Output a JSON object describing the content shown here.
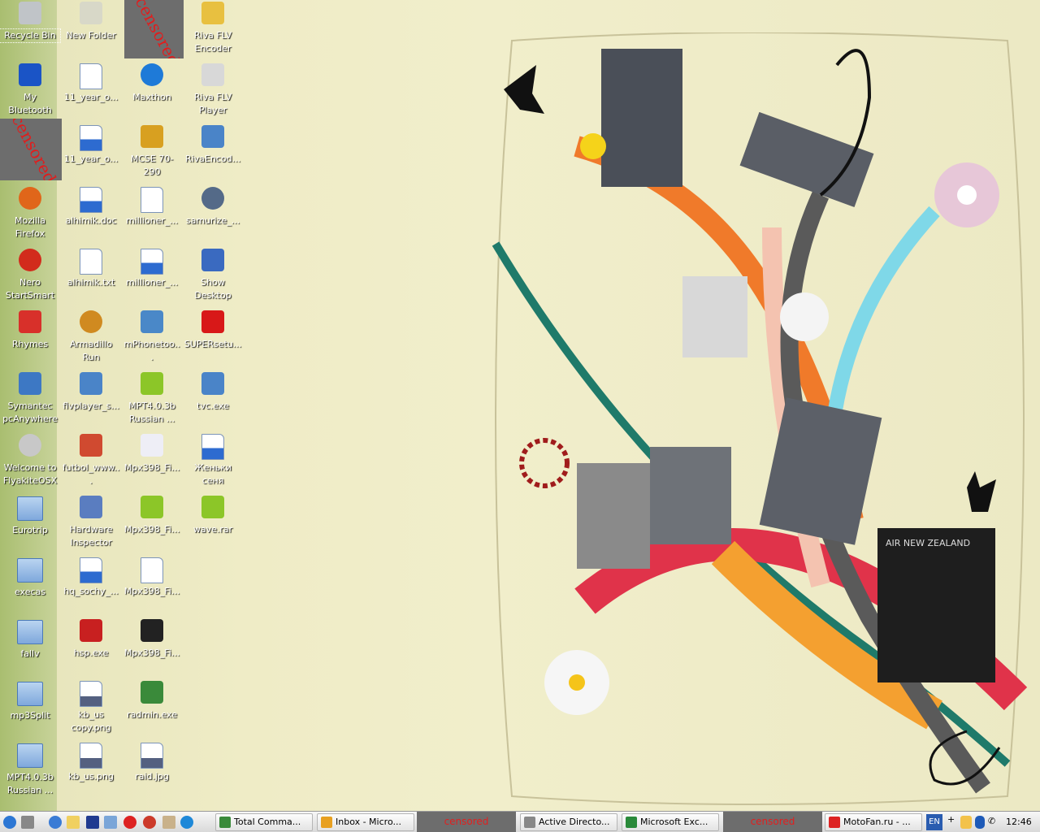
{
  "desktop_icons": [
    {
      "label": "Recycle Bin",
      "icon": "recycle-bin-icon",
      "selected": true
    },
    {
      "label": "My Bluetooth Places",
      "icon": "bluetooth-icon"
    },
    {
      "label": "Mozilla Firefox",
      "icon": "firefox-icon"
    },
    {
      "label": "Nero StartSmart",
      "icon": "nero-icon"
    },
    {
      "label": "Rhymes",
      "icon": "rhymes-icon"
    },
    {
      "label": "Symantec pcAnywhere",
      "icon": "pcanywhere-icon"
    },
    {
      "label": "Welcome to FlyakiteOSX",
      "icon": "flyakite-icon"
    },
    {
      "label": "Eurotrip",
      "icon": "folder-icon"
    },
    {
      "label": "execas",
      "icon": "folder-icon"
    },
    {
      "label": "fallv",
      "icon": "folder-icon"
    },
    {
      "label": "mp3Split",
      "icon": "folder-icon"
    },
    {
      "label": "MPT4.0.3b Russian ...",
      "icon": "folder-icon"
    },
    {
      "label": "New Folder",
      "icon": "help-folder-icon"
    },
    {
      "label": "11_year_o...",
      "icon": "document-icon"
    },
    {
      "label": "11_year_o...",
      "icon": "word-document-icon"
    },
    {
      "label": "alhimik.doc",
      "icon": "word-document-icon"
    },
    {
      "label": "alhimik.txt",
      "icon": "text-file-icon"
    },
    {
      "label": "Armadillo Run",
      "icon": "armadillo-icon"
    },
    {
      "label": "flvplayer_s...",
      "icon": "installer-icon"
    },
    {
      "label": "futbol_www...",
      "icon": "calendar-file-icon"
    },
    {
      "label": "Hardware Inspector",
      "icon": "hardware-inspector-icon"
    },
    {
      "label": "hq_sochy_...",
      "icon": "word-document-icon"
    },
    {
      "label": "hsp.exe",
      "icon": "hsp-exe-icon"
    },
    {
      "label": "kb_us copy.png",
      "icon": "png-file-icon"
    },
    {
      "label": "kb_us.png",
      "icon": "png-file-icon"
    },
    {
      "label": "Maxthon",
      "icon": "maxthon-icon"
    },
    {
      "label": "MCSE 70-290",
      "icon": "gear-icon"
    },
    {
      "label": "millioner_...",
      "icon": "document-icon"
    },
    {
      "label": "millioner_...",
      "icon": "word-document-icon"
    },
    {
      "label": "mPhonetoo...",
      "icon": "phone-tool-icon"
    },
    {
      "label": "MPT4.0.3b Russian ...",
      "icon": "archive-icon"
    },
    {
      "label": "Mpx398_Fi...",
      "icon": "blank-window-icon"
    },
    {
      "label": "Mpx398_Fi...",
      "icon": "archive-icon"
    },
    {
      "label": "Mpx398_Fi...",
      "icon": "blank-file-icon"
    },
    {
      "label": "Mpx398_Fi...",
      "icon": "7zip-icon"
    },
    {
      "label": "radmin.exe",
      "icon": "radmin-icon"
    },
    {
      "label": "raid.jpg",
      "icon": "jpeg-file-icon"
    },
    {
      "label": "Riva FLV Encoder",
      "icon": "riva-encoder-icon"
    },
    {
      "label": "Riva FLV Player",
      "icon": "riva-player-icon"
    },
    {
      "label": "RivaEncod...",
      "icon": "installer-icon"
    },
    {
      "label": "samurize_...",
      "icon": "samurize-icon"
    },
    {
      "label": "Show Desktop",
      "icon": "show-desktop-icon"
    },
    {
      "label": "SUPERsetu...",
      "icon": "super-setup-icon"
    },
    {
      "label": "tvc.exe",
      "icon": "installer-icon"
    },
    {
      "label": "Женьки сеня Двадцать ...",
      "icon": "word-document-icon"
    },
    {
      "label": "wave.rar",
      "icon": "archive-icon"
    }
  ],
  "censored_text": "censored",
  "taskbar": {
    "buttons": [
      {
        "label": "Total Comma...",
        "icon": "total-commander-icon"
      },
      {
        "label": "Inbox - Micro...",
        "icon": "outlook-icon"
      },
      {
        "label": "censored",
        "icon": "",
        "censored": true
      },
      {
        "label": "Active Directo...",
        "icon": "active-directory-icon"
      },
      {
        "label": "Microsoft Exc...",
        "icon": "excel-icon"
      },
      {
        "label": "censored",
        "icon": "",
        "censored": true
      },
      {
        "label": "MotoFan.ru - ...",
        "icon": "opera-icon"
      }
    ],
    "language": "EN",
    "clock": "12:46"
  },
  "wallpaper": {
    "sign_text": "AIR NEW ZEALAND"
  },
  "colors": {
    "taskbar_bg": "#e4e4e4",
    "censor_gray": "#6d6d6d",
    "censor_red": "#e21c1c",
    "label_white": "#ffffff"
  }
}
